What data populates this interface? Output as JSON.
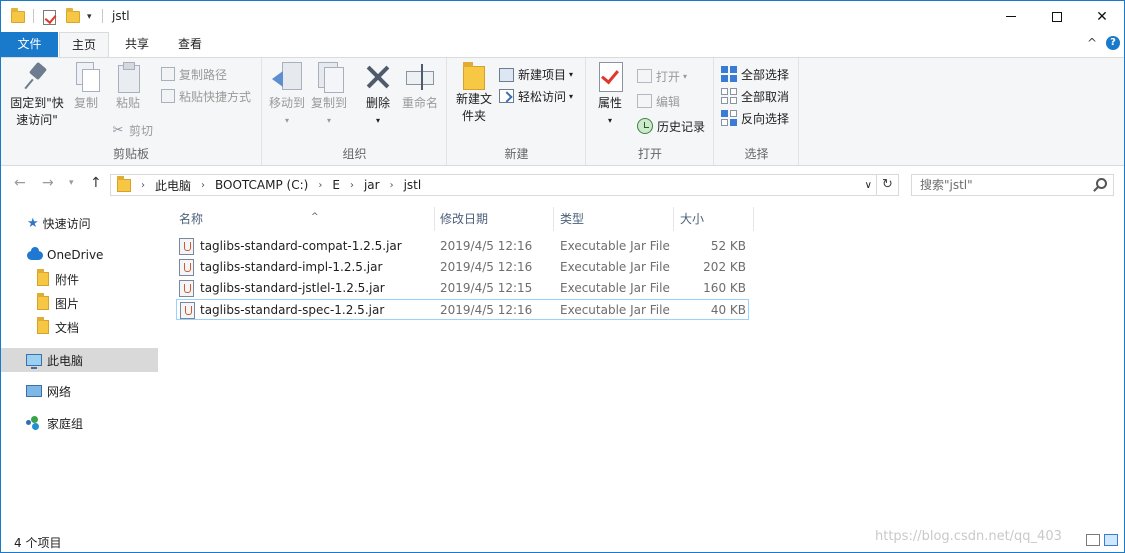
{
  "window": {
    "title": "jstl",
    "controls": {
      "minimize": "minimize",
      "maximize": "maximize",
      "close": "✕"
    }
  },
  "tabs": {
    "file": "文件",
    "home": "主页",
    "share": "共享",
    "view": "查看"
  },
  "ribbon": {
    "clipboard": {
      "label": "剪贴板",
      "pin": "固定到\"快速访问\"",
      "copy": "复制",
      "paste": "粘贴",
      "copy_path": "复制路径",
      "paste_shortcut": "粘贴快捷方式",
      "cut": "剪切"
    },
    "organize": {
      "label": "组织",
      "move_to": "移动到",
      "copy_to": "复制到",
      "delete": "删除",
      "rename": "重命名"
    },
    "new": {
      "label": "新建",
      "new_folder": "新建文件夹",
      "new_item": "新建项目",
      "easy_access": "轻松访问"
    },
    "open": {
      "label": "打开",
      "properties": "属性",
      "open": "打开",
      "edit": "编辑",
      "history": "历史记录"
    },
    "select": {
      "label": "选择",
      "select_all": "全部选择",
      "select_none": "全部取消",
      "invert": "反向选择"
    }
  },
  "address": {
    "crumbs": [
      "此电脑",
      "BOOTCAMP (C:)",
      "E",
      "jar",
      "jstl"
    ],
    "search_placeholder": "搜索\"jstl\""
  },
  "nav": {
    "quick_access": "快速访问",
    "onedrive": "OneDrive",
    "attachments": "附件",
    "pictures": "图片",
    "documents": "文档",
    "this_pc": "此电脑",
    "network": "网络",
    "homegroup": "家庭组"
  },
  "columns": {
    "name": "名称",
    "modified": "修改日期",
    "type": "类型",
    "size": "大小"
  },
  "files": [
    {
      "name": "taglibs-standard-compat-1.2.5.jar",
      "modified": "2019/4/5 12:16",
      "type": "Executable Jar File",
      "size": "52 KB"
    },
    {
      "name": "taglibs-standard-impl-1.2.5.jar",
      "modified": "2019/4/5 12:16",
      "type": "Executable Jar File",
      "size": "202 KB"
    },
    {
      "name": "taglibs-standard-jstlel-1.2.5.jar",
      "modified": "2019/4/5 12:15",
      "type": "Executable Jar File",
      "size": "160 KB"
    },
    {
      "name": "taglibs-standard-spec-1.2.5.jar",
      "modified": "2019/4/5 12:16",
      "type": "Executable Jar File",
      "size": "40 KB"
    }
  ],
  "status": {
    "count": "4 个项目"
  },
  "watermark": "https://blog.csdn.net/qq_403"
}
